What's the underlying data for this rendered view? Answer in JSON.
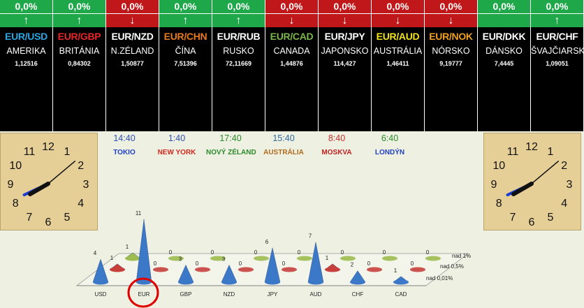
{
  "pairs": [
    {
      "pct": "0,0%",
      "dir": "up",
      "arrow": "↑",
      "code": "EUR/USD",
      "code_color": "#2aa7e0",
      "country": "AMERIKA",
      "rate": "1,12516"
    },
    {
      "pct": "0,0%",
      "dir": "up",
      "arrow": "↑",
      "code": "EUR/GBP",
      "code_color": "#e8262a",
      "country": "BRITÁNIA",
      "rate": "0,84302"
    },
    {
      "pct": "0,0%",
      "dir": "down",
      "arrow": "↓",
      "code": "EUR/NZD",
      "code_color": "#ffffff",
      "country": "N.ZÉLAND",
      "rate": "1,50877"
    },
    {
      "pct": "0,0%",
      "dir": "up",
      "arrow": "↑",
      "code": "EUR/CHN",
      "code_color": "#e87a1e",
      "country": "ČÍNA",
      "rate": "7,51396"
    },
    {
      "pct": "0,0%",
      "dir": "up",
      "arrow": "↑",
      "code": "EUR/RUB",
      "code_color": "#ffffff",
      "country": "RUSKO",
      "rate": "72,11669"
    },
    {
      "pct": "0,0%",
      "dir": "down",
      "arrow": "↓",
      "code": "EUR/CAD",
      "code_color": "#7ab648",
      "country": "CANADA",
      "rate": "1,44876"
    },
    {
      "pct": "0,0%",
      "dir": "down",
      "arrow": "↓",
      "code": "EUR/JPY",
      "code_color": "#ffffff",
      "country": "JAPONSKO",
      "rate": "114,427"
    },
    {
      "pct": "0,0%",
      "dir": "down",
      "arrow": "↓",
      "code": "EUR/AUD",
      "code_color": "#f2e21a",
      "country": "AUSTRÁLIA",
      "rate": "1,46411"
    },
    {
      "pct": "0,0%",
      "dir": "down",
      "arrow": "↓",
      "code": "EUR/NOK",
      "code_color": "#f0a020",
      "country": "NÓRSKO",
      "rate": "9,19777"
    },
    {
      "pct": "0,0%",
      "dir": "none",
      "arrow": "",
      "code": "EUR/DKK",
      "code_color": "#ffffff",
      "country": "DÁNSKO",
      "rate": "7,4445"
    },
    {
      "pct": "0,0%",
      "dir": "up",
      "arrow": "↑",
      "code": "EUR/CHF",
      "code_color": "#ffffff",
      "country": "ŠVAJČIARSKO",
      "rate": "1,09051"
    }
  ],
  "timezones": [
    {
      "time": "14:40",
      "time_color": "#2e4fb0",
      "city": "TOKIO",
      "city_color": "#2040c0"
    },
    {
      "time": "1:40",
      "time_color": "#2e4fb0",
      "city": "NEW YORK",
      "city_color": "#d0281e"
    },
    {
      "time": "17:40",
      "time_color": "#2a8a2a",
      "city": "NOVÝ ZÉLAND",
      "city_color": "#2a8a2a"
    },
    {
      "time": "15:40",
      "time_color": "#2e6aa0",
      "city": "AUSTRÁLIA",
      "city_color": "#b06a1e"
    },
    {
      "time": "8:40",
      "time_color": "#c03030",
      "city": "MOSKVA",
      "city_color": "#c02020"
    },
    {
      "time": "6:40",
      "time_color": "#2a8a2a",
      "city": "LONDÝN",
      "city_color": "#2040c0"
    }
  ],
  "clock_numbers": [
    "12",
    "1",
    "2",
    "3",
    "4",
    "5",
    "6",
    "7",
    "8",
    "9",
    "10",
    "11"
  ],
  "chart_data": {
    "type": "bar",
    "categories": [
      "USD",
      "EUR",
      "GBP",
      "NZD",
      "JPY",
      "AUD",
      "CHF",
      "CAD"
    ],
    "row_labels": [
      "nad 1%",
      "nad 0,5%",
      "nad 0,01%"
    ],
    "series": [
      {
        "name": "nad 0,01%",
        "color": "#3c78c8",
        "values": [
          4,
          11,
          3,
          3,
          6,
          7,
          2,
          1
        ]
      },
      {
        "name": "nad 0,5%",
        "color": "#c8403c",
        "values": [
          1,
          0,
          0,
          0,
          0,
          1,
          0,
          0
        ]
      },
      {
        "name": "nad 1%",
        "color": "#9cbc50",
        "values": [
          1,
          0,
          0,
          0,
          0,
          0,
          0,
          0
        ]
      }
    ],
    "highlight_category": "EUR"
  }
}
